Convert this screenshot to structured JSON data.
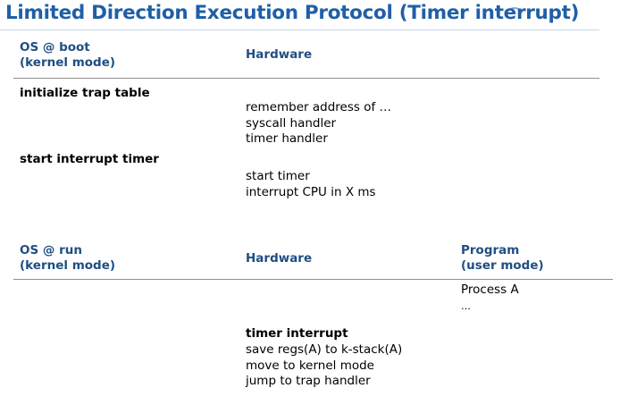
{
  "title": "Limited Direction Execution Protocol (Timer interrupt)",
  "boot_section": {
    "os_header": [
      "OS @ boot",
      "(kernel mode)"
    ],
    "hw_header": "Hardware",
    "init_trap": "initialize trap table",
    "remember_lines": [
      "remember address of …",
      "syscall handler",
      "timer handler"
    ],
    "start_timer_os": "start interrupt timer",
    "timer_lines": [
      "start timer",
      "interrupt CPU in X ms"
    ]
  },
  "run_section": {
    "os_header": [
      "OS @ run",
      "(kernel mode)"
    ],
    "hw_header": "Hardware",
    "program_header": [
      "Program",
      "(user mode)"
    ],
    "process": [
      "Process A",
      "…"
    ],
    "timer_interrupt": "timer interrupt",
    "interrupt_lines": [
      "save regs(A) to k-stack(A)",
      "move to kernel mode",
      "jump to trap handler"
    ]
  }
}
